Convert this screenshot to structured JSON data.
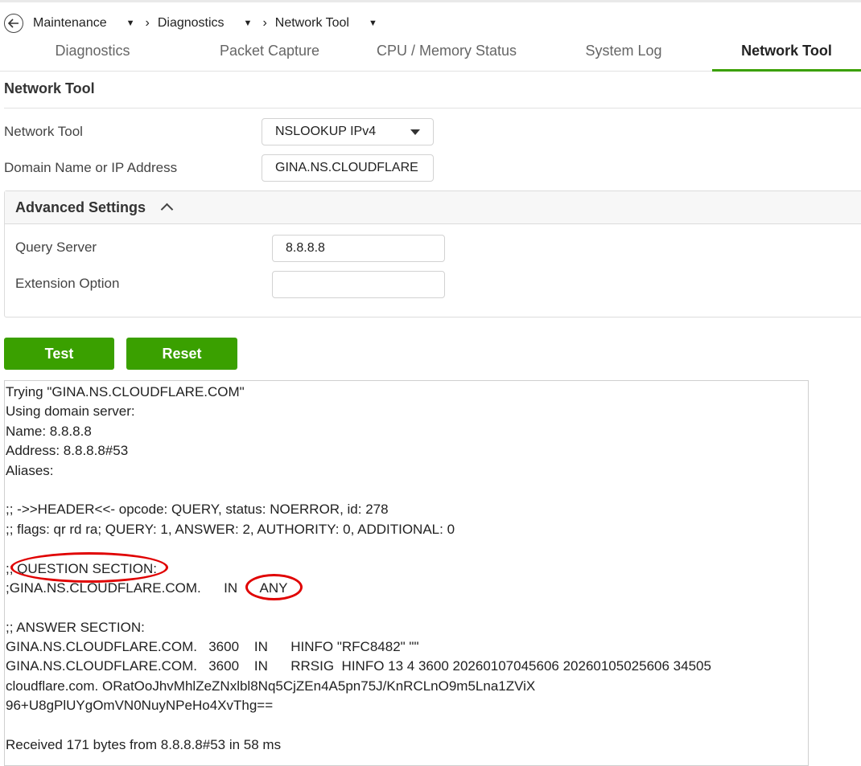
{
  "breadcrumb": [
    {
      "label": "Maintenance"
    },
    {
      "label": "Diagnostics"
    },
    {
      "label": "Network Tool"
    }
  ],
  "tabs": [
    {
      "label": "Diagnostics",
      "active": false
    },
    {
      "label": "Packet Capture",
      "active": false
    },
    {
      "label": "CPU / Memory Status",
      "active": false
    },
    {
      "label": "System Log",
      "active": false
    },
    {
      "label": "Network Tool",
      "active": true
    }
  ],
  "section_title": "Network Tool",
  "form": {
    "tool_label": "Network Tool",
    "tool_value": "NSLOOKUP IPv4",
    "domain_label": "Domain Name or IP Address",
    "domain_value": "GINA.NS.CLOUDFLARE"
  },
  "advanced": {
    "title": "Advanced Settings",
    "query_server_label": "Query Server",
    "query_server_value": "8.8.8.8",
    "extension_label": "Extension Option",
    "extension_value": ""
  },
  "buttons": {
    "test": "Test",
    "reset": "Reset"
  },
  "output_lines": [
    "Trying \"GINA.NS.CLOUDFLARE.COM\"",
    "Using domain server:",
    "Name: 8.8.8.8",
    "Address: 8.8.8.8#53",
    "Aliases:",
    "",
    ";; ->>HEADER<<- opcode: QUERY, status: NOERROR, id: 278",
    ";; flags: qr rd ra; QUERY: 1, ANSWER: 2, AUTHORITY: 0, ADDITIONAL: 0",
    "",
    ";; QUESTION SECTION:",
    ";GINA.NS.CLOUDFLARE.COM.      IN      ANY",
    "",
    ";; ANSWER SECTION:",
    "GINA.NS.CLOUDFLARE.COM.   3600    IN      HINFO \"RFC8482\" \"\"",
    "GINA.NS.CLOUDFLARE.COM.   3600    IN      RRSIG  HINFO 13 4 3600 20260107045606 20260105025606 34505",
    "cloudflare.com. ORatOoJhvMhlZeZNxlbl8Nq5CjZEn4A5pn75J/KnRCLnO9m5Lna1ZViX",
    "96+U8gPlUYgOmVN0NuyNPeHo4XvThg==",
    "",
    "Received 171 bytes from 8.8.8.8#53 in 58 ms"
  ],
  "colors": {
    "accent": "#3aa000",
    "annotation": "#e00000"
  }
}
